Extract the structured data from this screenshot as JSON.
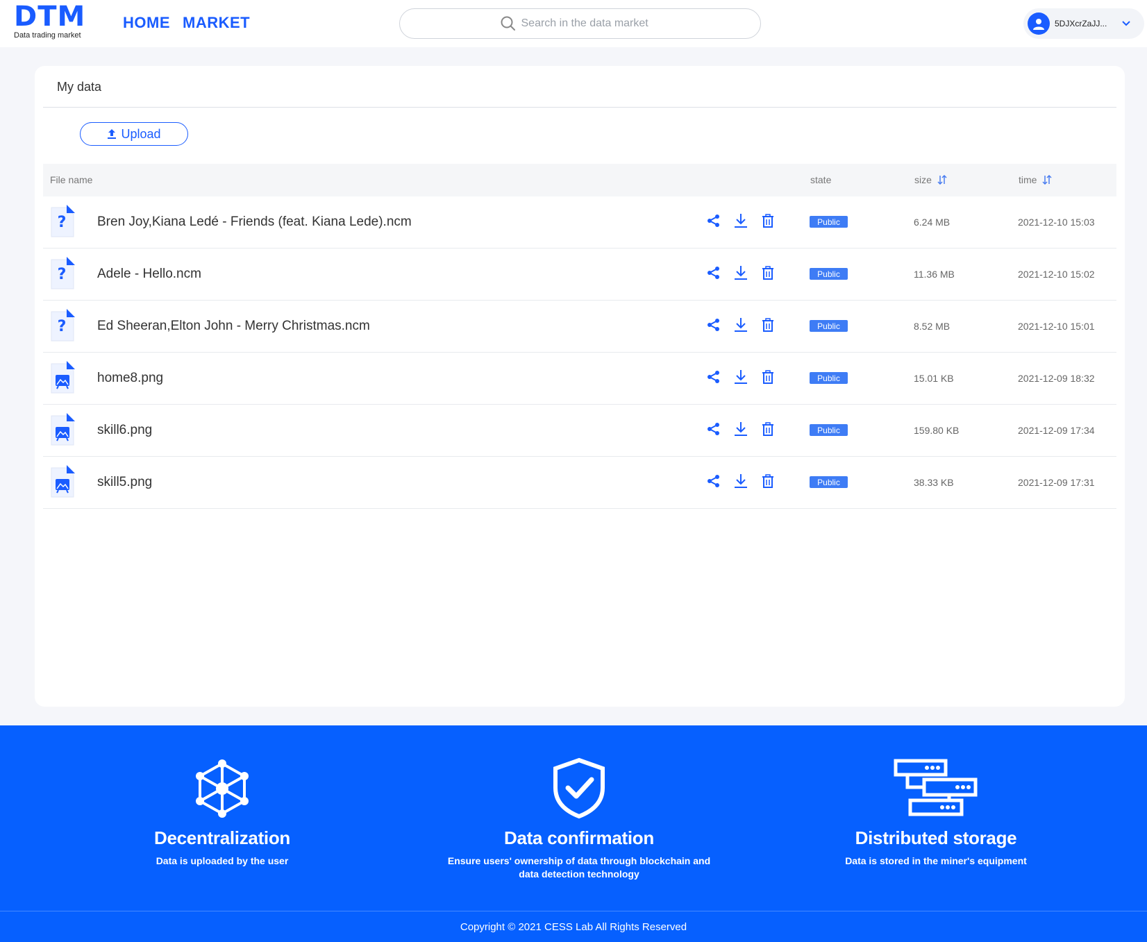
{
  "header": {
    "logo_text": "DTM",
    "logo_subtitle": "Data trading market",
    "nav": [
      {
        "label": "HOME"
      },
      {
        "label": "MARKET"
      }
    ],
    "search_placeholder": "Search in the data market",
    "user_name": "5DJXcrZaJJ..."
  },
  "card": {
    "title": "My data",
    "upload_label": "Upload",
    "columns": {
      "file_name": "File name",
      "state": "state",
      "size": "size",
      "time": "time"
    },
    "rows": [
      {
        "name": "Bren Joy,Kiana Ledé - Friends (feat. Kiana Lede).ncm",
        "type": "unknown",
        "state": "Public",
        "size": "6.24 MB",
        "time": "2021-12-10 15:03"
      },
      {
        "name": "Adele - Hello.ncm",
        "type": "unknown",
        "state": "Public",
        "size": "11.36 MB",
        "time": "2021-12-10 15:02"
      },
      {
        "name": "Ed Sheeran,Elton John - Merry Christmas.ncm",
        "type": "unknown",
        "state": "Public",
        "size": "8.52 MB",
        "time": "2021-12-10 15:01"
      },
      {
        "name": "home8.png",
        "type": "image",
        "state": "Public",
        "size": "15.01 KB",
        "time": "2021-12-09 18:32"
      },
      {
        "name": "skill6.png",
        "type": "image",
        "state": "Public",
        "size": "159.80 KB",
        "time": "2021-12-09 17:34"
      },
      {
        "name": "skill5.png",
        "type": "image",
        "state": "Public",
        "size": "38.33 KB",
        "time": "2021-12-09 17:31"
      }
    ]
  },
  "footer": {
    "features": [
      {
        "icon": "cube-network-icon",
        "title": "Decentralization",
        "desc": "Data is uploaded by the user"
      },
      {
        "icon": "shield-check-icon",
        "title": "Data confirmation",
        "desc": "Ensure users' ownership of data through blockchain and data detection technology"
      },
      {
        "icon": "server-stack-icon",
        "title": "Distributed storage",
        "desc": "Data is stored in the miner's equipment"
      }
    ],
    "copyright": "Copyright © 2021 CESS Lab All Rights Reserved"
  },
  "colors": {
    "brand": "#1a5cff",
    "footer_bg": "#0660ff",
    "badge": "#3e7cf5"
  }
}
